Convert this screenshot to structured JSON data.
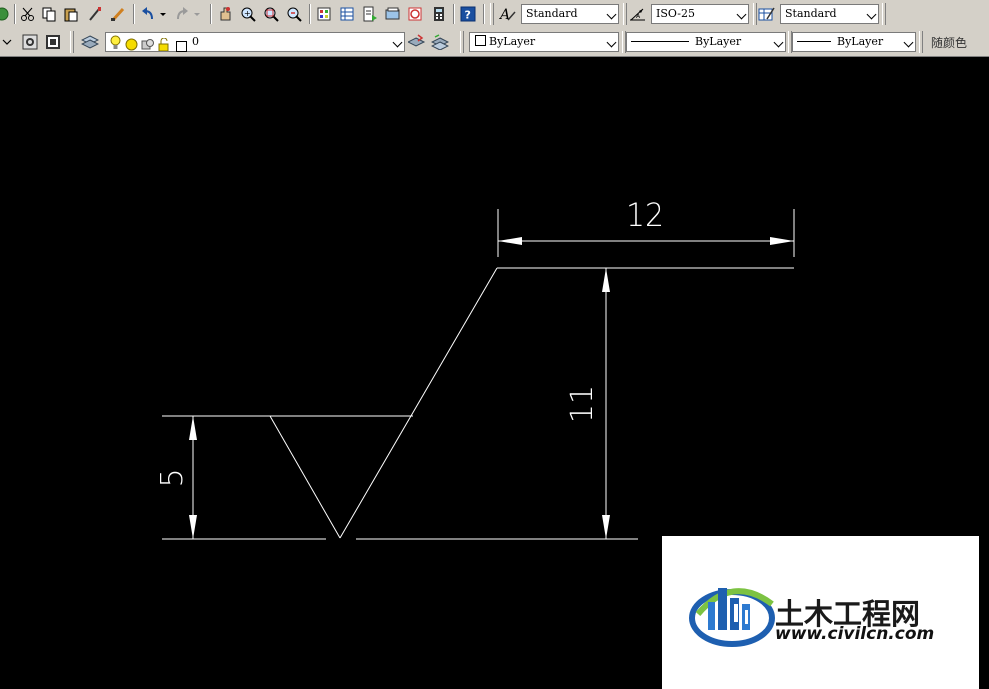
{
  "toolbar": {
    "text_style": "Standard",
    "dim_style": "ISO-25",
    "table_style": "Standard",
    "layer_name": "0",
    "color_control": "ByLayer",
    "linetype_control": "ByLayer",
    "lineweight_control": "ByLayer",
    "plot_style": "随颜色"
  },
  "drawing": {
    "dim_top": "12",
    "dim_right": "11",
    "dim_left": "5"
  },
  "watermark": {
    "site_name": "土木工程网",
    "url": "www.civilcn.com"
  },
  "colors": {
    "canvas_bg": "#000000",
    "toolbar_bg": "#d4d0c8",
    "line_color": "#ffffff",
    "logo_blue": "#1e5fb0",
    "logo_green": "#7cc242"
  }
}
